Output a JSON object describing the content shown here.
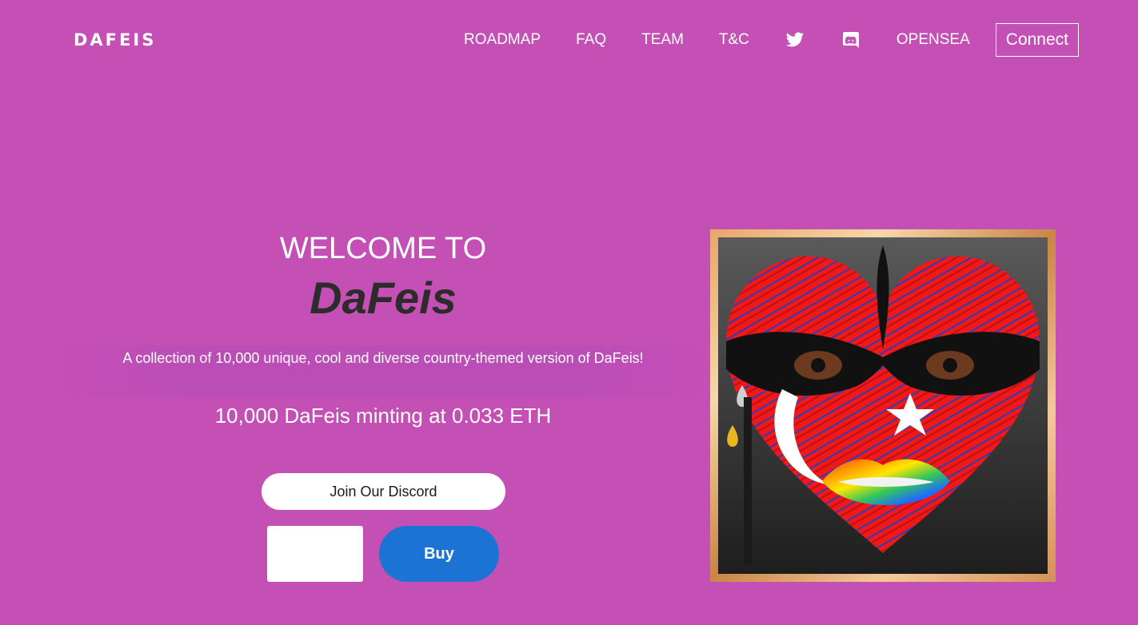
{
  "header": {
    "brand": "DAFEIS",
    "nav": {
      "roadmap": "ROADMAP",
      "faq": "FAQ",
      "team": "TEAM",
      "tc": "T&C",
      "opensea": "OPENSEA"
    },
    "connect_label": "Connect"
  },
  "hero": {
    "welcome": "WELCOME TO",
    "name": "DaFeis",
    "description": "A collection of 10,000 unique, cool and diverse country-themed version of DaFeis!",
    "minting": "10,000 DaFeis minting at 0.033 ETH",
    "discord_button": "Join Our Discord",
    "quantity_value": "",
    "buy_button": "Buy"
  },
  "colors": {
    "background": "#c44fb5",
    "buy_button": "#1b74d4",
    "heading_dark": "#2c2c2c"
  },
  "icons": {
    "twitter": "twitter-icon",
    "discord": "discord-icon"
  }
}
